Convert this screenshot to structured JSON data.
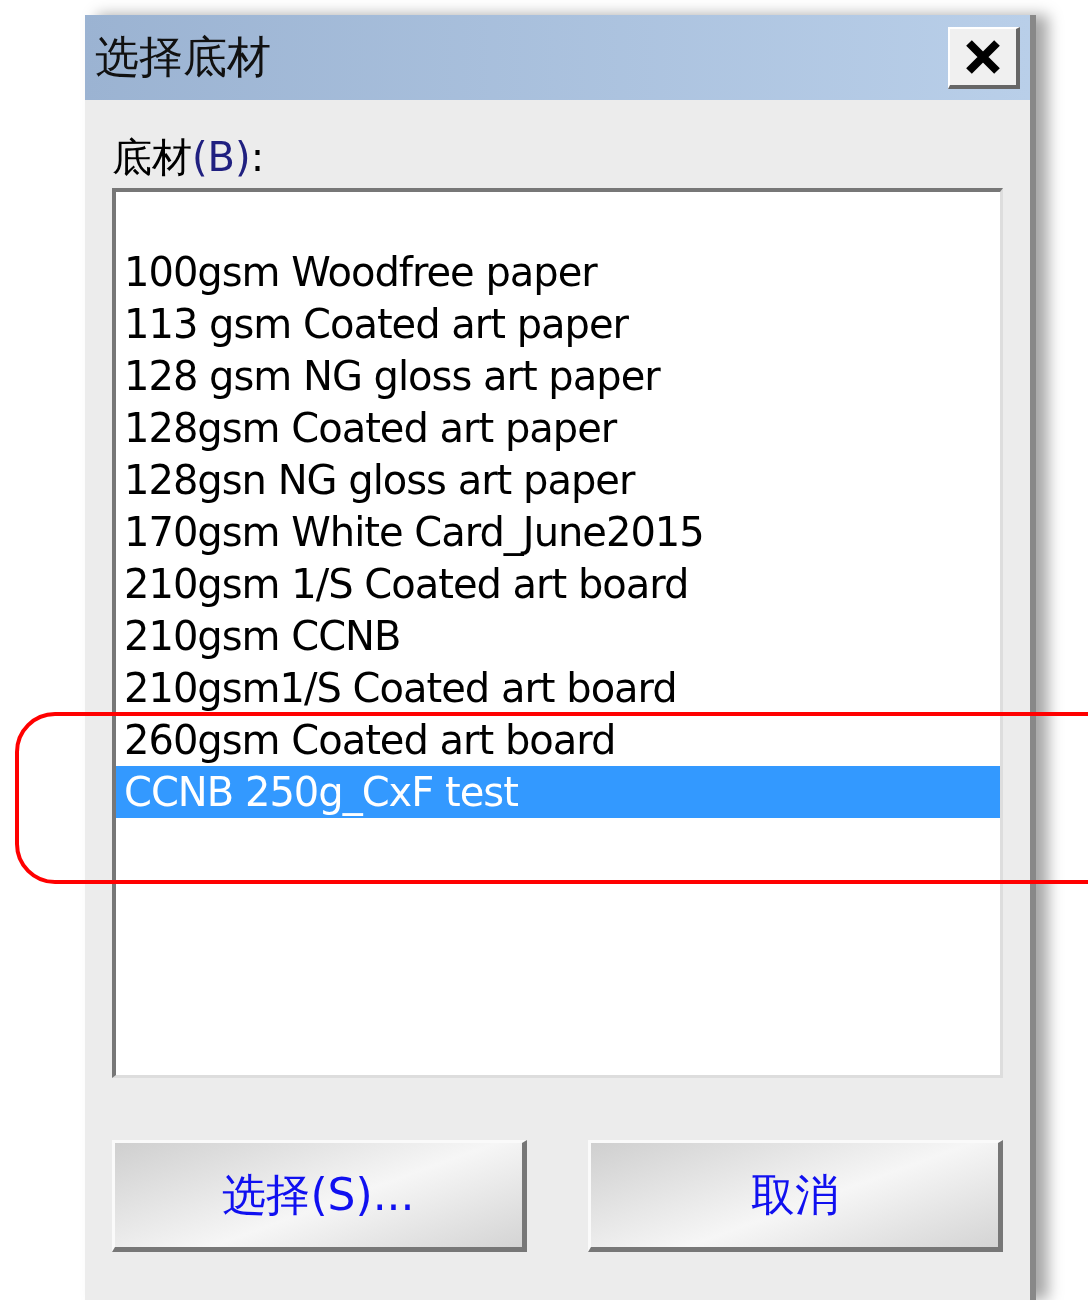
{
  "window": {
    "title": "选择底材"
  },
  "list_label": {
    "text": "底材",
    "accel": "(B)",
    "suffix": ":"
  },
  "items": [
    {
      "label": "100gsm Woodfree paper",
      "selected": false
    },
    {
      "label": "113 gsm Coated art paper",
      "selected": false
    },
    {
      "label": "128 gsm NG gloss art paper",
      "selected": false
    },
    {
      "label": "128gsm Coated art paper",
      "selected": false
    },
    {
      "label": "128gsn NG gloss art paper",
      "selected": false
    },
    {
      "label": "170gsm White Card_June2015",
      "selected": false
    },
    {
      "label": "210gsm 1/S Coated art board",
      "selected": false
    },
    {
      "label": "210gsm CCNB",
      "selected": false
    },
    {
      "label": "210gsm1/S Coated art board",
      "selected": false
    },
    {
      "label": "260gsm Coated art board",
      "selected": false
    },
    {
      "label": "CCNB 250g_CxF test",
      "selected": true
    }
  ],
  "buttons": [
    {
      "label": "选择(S)..."
    },
    {
      "label": "取消"
    }
  ],
  "annotation": {
    "kind": "rounded-frame",
    "color": "#ff0000"
  }
}
